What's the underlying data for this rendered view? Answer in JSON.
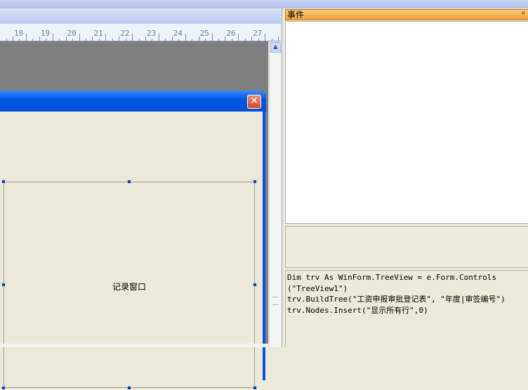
{
  "ruler": {
    "numbers": [
      "18",
      "19",
      "20",
      "21",
      "22",
      "23",
      "24",
      "25",
      "26",
      "27"
    ]
  },
  "form": {
    "close_icon": "close-icon",
    "frame_label": "记录窗口"
  },
  "events_panel": {
    "title": "事件",
    "pin_icon": "pin-icon",
    "pin_glyph": "ᵖ"
  },
  "code": {
    "lines": [
      "Dim trv As WinForm.TreeView = e.Form.Controls",
      "(\"TreeView1\")",
      "trv.BuildTree(\"工资申报审批登记表\", \"年度|审签编号\")",
      "trv.Nodes.Insert(\"显示所有行\",0)"
    ]
  },
  "colors": {
    "title_bar": "#0058e6",
    "close_button": "#d64d2a",
    "events_header": "#f0a33f",
    "canvas": "#808080",
    "form_body": "#ece9d8"
  }
}
